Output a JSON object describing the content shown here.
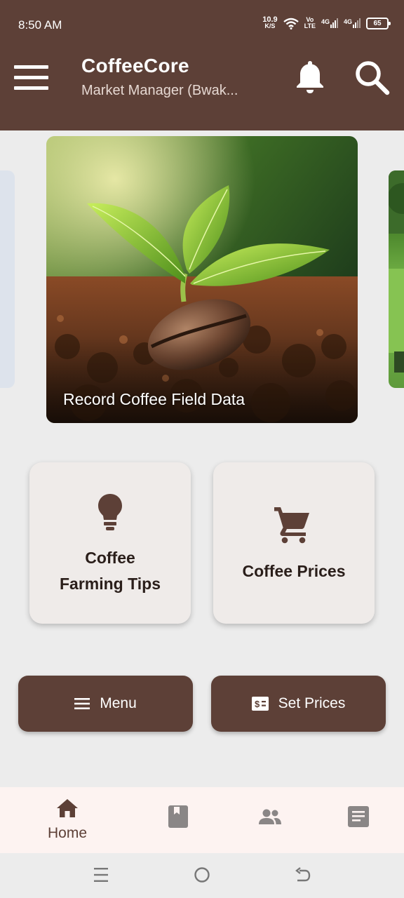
{
  "status_bar": {
    "time": "8:50 AM",
    "net_speed_value": "10.9",
    "net_speed_unit": "K/S",
    "volte_top": "Vo",
    "volte_bottom": "LTE",
    "sim1": "4G",
    "sim2": "4G",
    "battery": "65"
  },
  "app_bar": {
    "title": "CoffeeCore",
    "subtitle": "Market Manager (Bwak..."
  },
  "carousel": {
    "main_caption": "Record Coffee Field Data"
  },
  "tiles": [
    {
      "label_line1": "Coffee",
      "label_line2": "Farming Tips",
      "icon": "lightbulb-icon"
    },
    {
      "label": "Coffee Prices",
      "icon": "cart-icon"
    }
  ],
  "buttons": {
    "menu_label": "Menu",
    "set_prices_label": "Set Prices"
  },
  "bottom_nav": {
    "home_label": "Home",
    "items": [
      "home-icon",
      "book-icon",
      "people-icon",
      "document-icon"
    ]
  },
  "colors": {
    "primary": "#5d4037",
    "tile_bg": "#efebe9",
    "nav_bg": "#fdf3f1",
    "inactive_icon": "#8a8686"
  }
}
